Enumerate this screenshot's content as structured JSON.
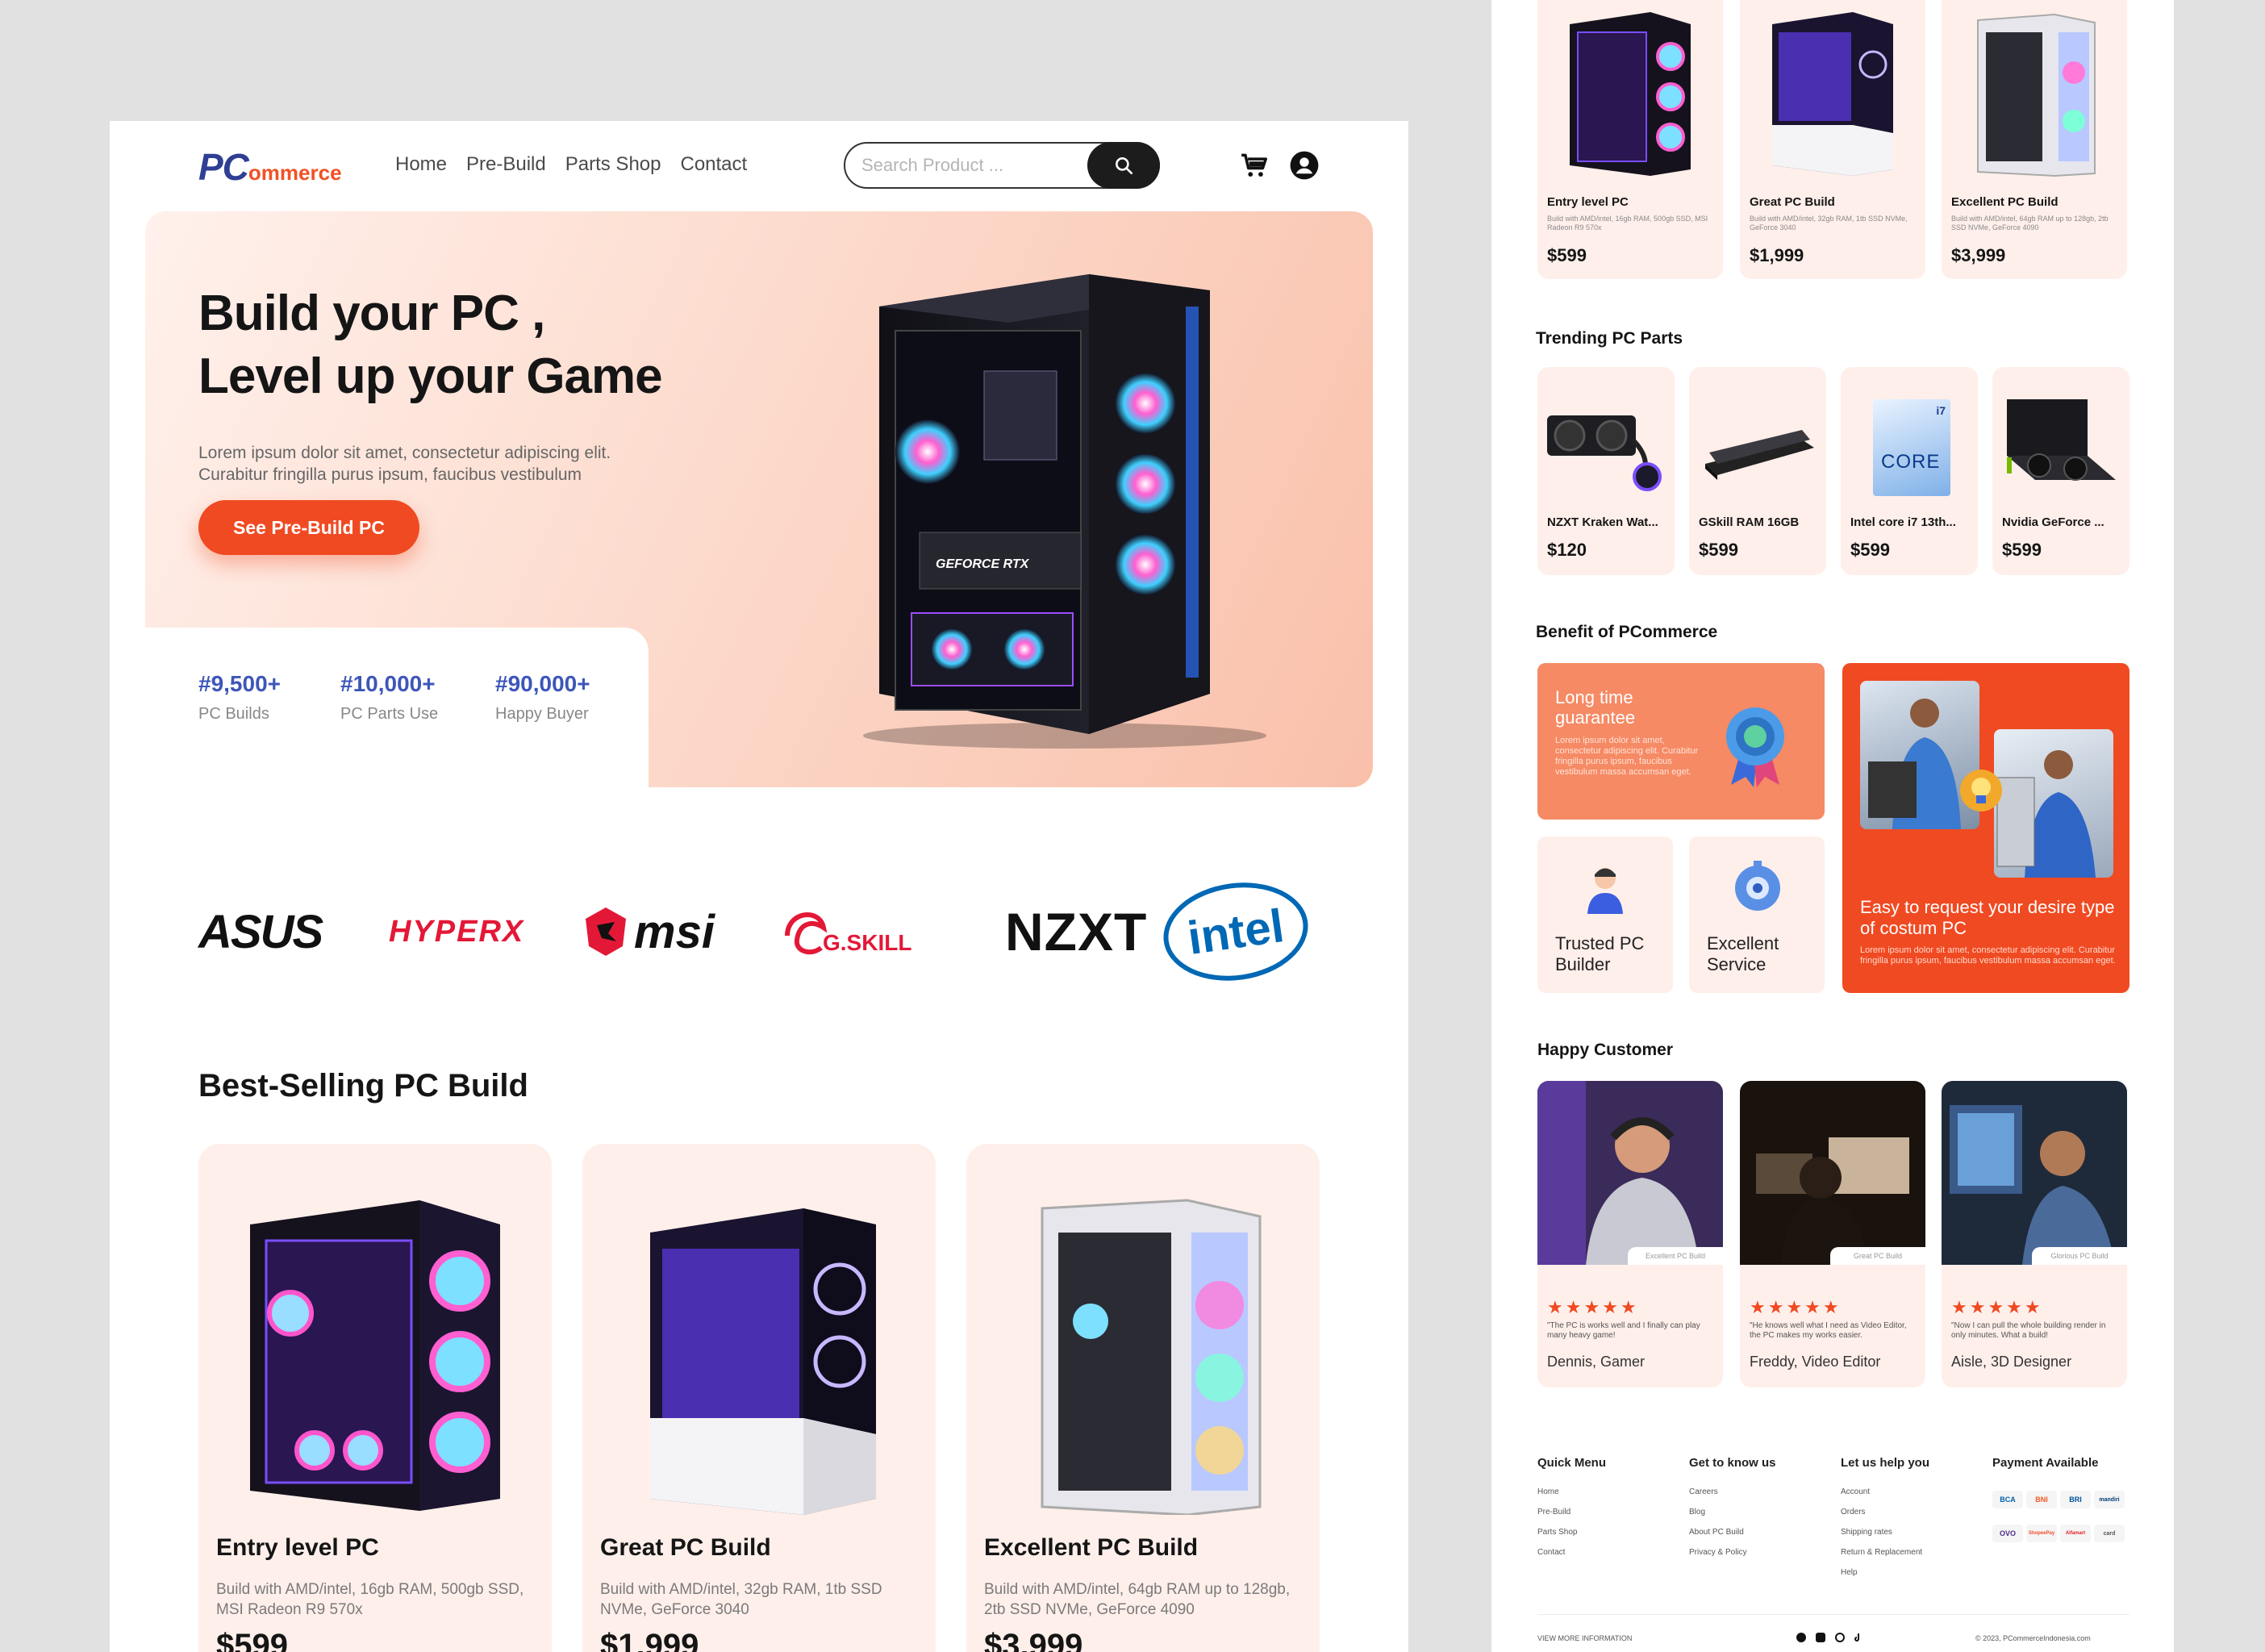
{
  "brand": {
    "logo_pc": "PC",
    "logo_rest": "ommerce"
  },
  "nav": [
    "Home",
    "Pre-Build",
    "Parts Shop",
    "Contact"
  ],
  "search": {
    "placeholder": "Search Product ..."
  },
  "hero": {
    "title_line1": "Build your PC ,",
    "title_line2": "Level up your Game",
    "subtitle_line1": "Lorem ipsum dolor sit amet, consectetur adipiscing elit.",
    "subtitle_line2": "Curabitur fringilla purus ipsum, faucibus vestibulum",
    "cta": "See Pre-Build PC",
    "gpu_label": "GEFORCE RTX"
  },
  "stats": [
    {
      "value": "#9,500+",
      "label": "PC Builds"
    },
    {
      "value": "#10,000+",
      "label": "PC Parts Use"
    },
    {
      "value": "#90,000+",
      "label": "Happy Buyer"
    }
  ],
  "brands": [
    "ASUS",
    "HYPERX",
    "msi",
    "G.SKILL",
    "NZXT",
    "intel"
  ],
  "best_selling": {
    "title": "Best-Selling PC Build",
    "items": [
      {
        "name": "Entry level PC",
        "desc": "Build with AMD/intel, 16gb RAM, 500gb SSD, MSI Radeon R9 570x",
        "price": "$599"
      },
      {
        "name": "Great PC Build",
        "desc": "Build with AMD/intel, 32gb RAM, 1tb SSD NVMe, GeForce 3040",
        "price": "$1,999"
      },
      {
        "name": "Excellent PC Build",
        "desc": "Build with AMD/intel, 64gb RAM up to 128gb, 2tb SSD NVMe, GeForce 4090",
        "price": "$3,999"
      }
    ]
  },
  "top_builds": [
    {
      "name": "Entry level PC",
      "desc": "Build with AMD/intel, 16gb RAM, 500gb SSD, MSI Radeon R9 570x",
      "price": "$599"
    },
    {
      "name": "Great PC Build",
      "desc": "Build with AMD/intel, 32gb RAM, 1tb SSD NVMe, GeForce 3040",
      "price": "$1,999"
    },
    {
      "name": "Excellent PC Build",
      "desc": "Build with AMD/intel, 64gb RAM up to 128gb, 2tb SSD NVMe, GeForce 4090",
      "price": "$3,999"
    }
  ],
  "trending": {
    "title": "Trending PC Parts",
    "items": [
      {
        "name": "NZXT Kraken Wat...",
        "price": "$120"
      },
      {
        "name": "GSkill RAM 16GB",
        "price": "$599"
      },
      {
        "name": "Intel core i7 13th...",
        "price": "$599"
      },
      {
        "name": "Nvidia GeForce ...",
        "price": "$599"
      }
    ],
    "cpu_box_text": "CORE",
    "cpu_box_badge": "i7"
  },
  "benefits": {
    "title": "Benefit of PCommerce",
    "guarantee_title": "Long time guarantee",
    "guarantee_desc": "Lorem ipsum dolor sit amet, consectetur adipiscing elit. Curabitur fringilla purus ipsum, faucibus vestibulum massa accumsan eget.",
    "trusted": "Trusted PC Builder",
    "service": "Excellent Service",
    "request_title": "Easy to request your desire type of costum PC",
    "request_desc": "Lorem ipsum dolor sit amet, consectetur adipiscing elit. Curabitur fringilla purus ipsum, faucibus vestibulum massa accumsan eget."
  },
  "customers": {
    "title": "Happy Customer",
    "items": [
      {
        "tag": "Excellent PC Build",
        "stars": "★★★★★",
        "quote": "\"The PC is works well and I finally can play many heavy game!",
        "name": "Dennis, Gamer"
      },
      {
        "tag": "Great PC Build",
        "stars": "★★★★★",
        "quote": "\"He knows well what I need as Video Editor, the PC makes my works easier.",
        "name": "Freddy, Video Editor"
      },
      {
        "tag": "Glorious PC Build",
        "stars": "★★★★★",
        "quote": "\"Now I can pull the whole building render in only minutes. What a build!",
        "name": "Aisle, 3D Designer"
      }
    ]
  },
  "footer": {
    "quick_menu": {
      "title": "Quick Menu",
      "links": [
        "Home",
        "Pre-Build",
        "Parts Shop",
        "Contact"
      ]
    },
    "know_us": {
      "title": "Get to know us",
      "links": [
        "Careers",
        "Blog",
        "About PC Build",
        "Privacy & Policy"
      ]
    },
    "help": {
      "title": "Let us help you",
      "links": [
        "Account",
        "Orders",
        "Shipping rates",
        "Return & Replacement",
        "Help"
      ]
    },
    "payment": {
      "title": "Payment Available",
      "methods": [
        "BCA",
        "BNI",
        "BRI",
        "mandiri",
        "OVO",
        "ShopeePay",
        "Alfamart",
        "card"
      ]
    },
    "view_more": "VIEW MORE INFORMATION",
    "copyright": "© 2023, PCommerceIndonesia.com"
  },
  "colors": {
    "accent": "#f04a22",
    "brand_blue": "#2f3f93",
    "stat_blue": "#3d56b8",
    "card_bg": "#ffefea"
  }
}
